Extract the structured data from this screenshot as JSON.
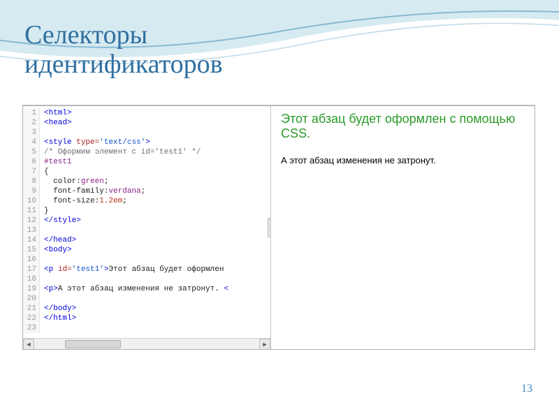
{
  "slide": {
    "title_line1": "Селекторы",
    "title_line2": "идентификаторов",
    "number": "13"
  },
  "code": {
    "lines": [
      {
        "n": "1",
        "html": "<span class='tag'>&lt;html&gt;</span>"
      },
      {
        "n": "2",
        "html": "<span class='tag'>&lt;head&gt;</span>"
      },
      {
        "n": "3",
        "html": ""
      },
      {
        "n": "4",
        "html": "<span class='tag'>&lt;style</span> <span class='attr'>type=</span><span class='val'>'text/css'</span><span class='tag'>&gt;</span>"
      },
      {
        "n": "5",
        "html": "<span class='cmt'>/* Оформим элемент с id='test1' */</span>"
      },
      {
        "n": "6",
        "html": "<span class='kw'>#test1</span>"
      },
      {
        "n": "7",
        "html": "<span class='txt'>{</span>"
      },
      {
        "n": "8",
        "html": "  <span class='txt'>color:</span><span class='kw'>green</span><span class='txt'>;</span>"
      },
      {
        "n": "9",
        "html": "  <span class='txt'>font-family:</span><span class='kw'>verdana</span><span class='txt'>;</span>"
      },
      {
        "n": "10",
        "html": "  <span class='txt'>font-size:</span><span class='num'>1.2em</span><span class='txt'>;</span>"
      },
      {
        "n": "11",
        "html": "<span class='txt'>}</span>"
      },
      {
        "n": "12",
        "html": "<span class='tag'>&lt;/style&gt;</span>"
      },
      {
        "n": "13",
        "html": ""
      },
      {
        "n": "14",
        "html": "<span class='tag'>&lt;/head&gt;</span>"
      },
      {
        "n": "15",
        "html": "<span class='tag'>&lt;body&gt;</span>"
      },
      {
        "n": "16",
        "html": ""
      },
      {
        "n": "17",
        "html": "<span class='tag'>&lt;p</span> <span class='attr'>id=</span><span class='val'>'test1'</span><span class='tag'>&gt;</span><span class='txt'>Этот абзац будет оформлен</span>"
      },
      {
        "n": "18",
        "html": ""
      },
      {
        "n": "19",
        "html": "<span class='tag'>&lt;p&gt;</span><span class='txt'>А этот абзац изменения не затронут. </span><span class='tag'>&lt;</span>"
      },
      {
        "n": "20",
        "html": ""
      },
      {
        "n": "21",
        "html": "<span class='tag'>&lt;/body&gt;</span>"
      },
      {
        "n": "22",
        "html": "<span class='tag'>&lt;/html&gt;</span>"
      },
      {
        "n": "23",
        "html": ""
      }
    ]
  },
  "preview": {
    "styled_text": "Этот абзац будет оформлен с помощью CSS.",
    "plain_text": "А этот абзац изменения не затронут."
  }
}
